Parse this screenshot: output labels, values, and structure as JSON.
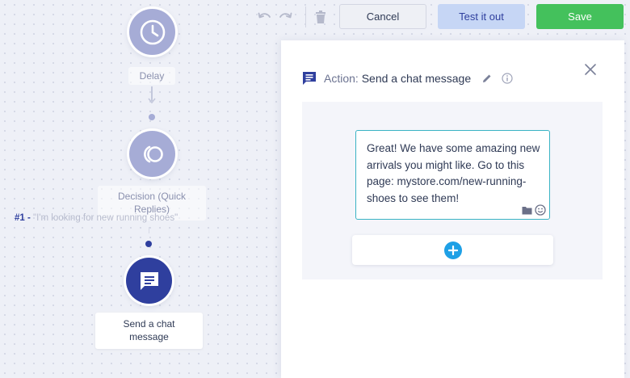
{
  "toolbar": {
    "undo_icon": "undo-icon",
    "redo_icon": "redo-icon",
    "delete_icon": "trash-icon",
    "cancel_label": "Cancel",
    "test_label": "Test it out",
    "save_label": "Save"
  },
  "flow": {
    "nodes": [
      {
        "label": "Delay",
        "icon": "clock-icon",
        "state": "faded"
      },
      {
        "label": "Decision (Quick Replies)",
        "icon": "decision-icon",
        "state": "faded"
      },
      {
        "label": "Send a chat message",
        "icon": "chat-message-icon",
        "state": "active"
      }
    ],
    "branch": {
      "number": "#1 -",
      "text": "\"I'm looking for new running shoes\""
    }
  },
  "panel": {
    "title_label": "Action:",
    "title_value": "Send a chat message",
    "message": {
      "text": "Great! We have some amazing new arrivals you might like. Go to this page: mystore.com/new-running-shoes to see them!"
    }
  },
  "colors": {
    "primary": "#2f3f9e",
    "faded_node": "#a6acd6",
    "save": "#44c15c",
    "test": "#c6d6f5",
    "accent_border": "#3ab3c4",
    "add_button": "#1ea0e6"
  }
}
